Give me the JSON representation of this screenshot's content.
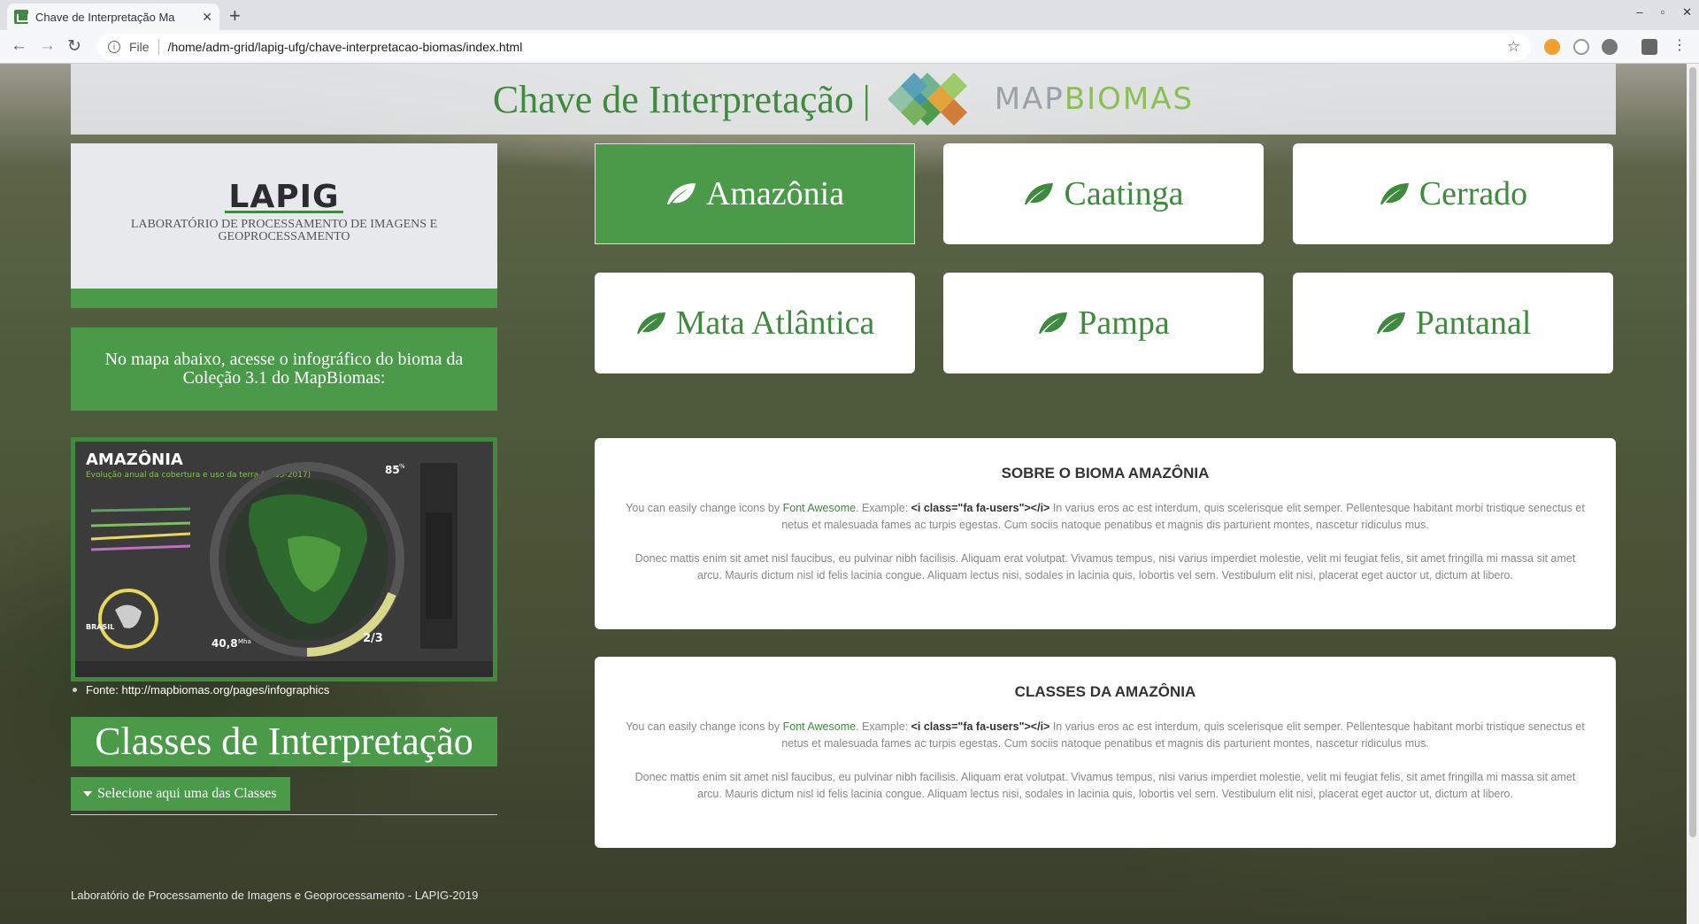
{
  "browser": {
    "tab_title": "Chave de Interpretação Ma",
    "tab_close": "✕",
    "new_tab": "+",
    "window_controls": [
      "–",
      "▫",
      "✕"
    ],
    "url_scheme": "File",
    "url": "/home/adm-grid/lapig-ufg/chave-interpretacao-biomas/index.html"
  },
  "header": {
    "title": "Chave de Interpretação",
    "pipe": "|",
    "brand_map": "MAP",
    "brand_biomas": "BIOMAS"
  },
  "sidebar": {
    "lapig_logo": "LAPIG",
    "lapig_subtitle": "LABORATÓRIO DE PROCESSAMENTO DE IMAGENS E GEOPROCESSAMENTO",
    "info_text": "No mapa abaixo, acesse o infográfico do bioma da Coleção 3.1 do MapBiomas:",
    "infographic": {
      "title": "AMAZÔNIA",
      "subtitle": "Evolução anual da cobertura e uso da terra (1985-2017)",
      "brasil": "BRASIL",
      "area": "40,8",
      "area_unit": "Mha",
      "fraction": "2/3",
      "pct_top": "85",
      "pct_sup": "%"
    },
    "fonte": "Fonte: http://mapbiomas.org/pages/infographics",
    "classes_title": "Classes de Interpretação",
    "classes_dropdown": "Selecione aqui uma das Classes"
  },
  "biomes": [
    {
      "label": "Amazônia",
      "active": true
    },
    {
      "label": "Caatinga",
      "active": false
    },
    {
      "label": "Cerrado",
      "active": false
    },
    {
      "label": "Mata Atlântica",
      "active": false
    },
    {
      "label": "Pampa",
      "active": false
    },
    {
      "label": "Pantanal",
      "active": false
    }
  ],
  "cards": [
    {
      "title": "SOBRE O BIOMA AMAZÔNIA",
      "p1_prefix": "You can easily change icons by ",
      "p1_link": "Font Awesome",
      "p1_mid": ". Example: ",
      "p1_code": "<i class=\"fa fa-users\"></i>",
      "p1_suffix": " In varius eros ac est interdum, quis scelerisque elit semper. Pellentesque habitant morbi tristique senectus et netus et malesuada fames ac turpis egestas. Cum sociis natoque penatibus et magnis dis parturient montes, nascetur ridiculus mus.",
      "p2": "Donec mattis enim sit amet nisl faucibus, eu pulvinar nibh facilisis. Aliquam erat volutpat. Vivamus tempus, nisi varius imperdiet molestie, velit mi feugiat felis, sit amet fringilla mi massa sit amet arcu. Mauris dictum nisl id felis lacinia congue. Aliquam lectus nisi, sodales in lacinia quis, lobortis vel sem. Vestibulum elit nisi, placerat eget auctor ut, dictum at libero."
    },
    {
      "title": "CLASSES DA AMAZÔNIA",
      "p1_prefix": "You can easily change icons by ",
      "p1_link": "Font Awesome",
      "p1_mid": ". Example: ",
      "p1_code": "<i class=\"fa fa-users\"></i>",
      "p1_suffix": " In varius eros ac est interdum, quis scelerisque elit semper. Pellentesque habitant morbi tristique senectus et netus et malesuada fames ac turpis egestas. Cum sociis natoque penatibus et magnis dis parturient montes, nascetur ridiculus mus.",
      "p2": "Donec mattis enim sit amet nisl faucibus, eu pulvinar nibh facilisis. Aliquam erat volutpat. Vivamus tempus, nisi varius imperdiet molestie, velit mi feugiat felis, sit amet fringilla mi massa sit amet arcu. Mauris dictum nisl id felis lacinia congue. Aliquam lectus nisi, sodales in lacinia quis, lobortis vel sem. Vestibulum elit nisi, placerat eget auctor ut, dictum at libero."
    }
  ],
  "footer": "Laboratório de Processamento de Imagens e Geoprocessamento - LAPIG-2019",
  "colors": {
    "accent": "#4a9a4a",
    "accent_dark": "#3f8a3f",
    "brand_green": "#8bbf55",
    "brand_grey": "#9aa2a8"
  }
}
